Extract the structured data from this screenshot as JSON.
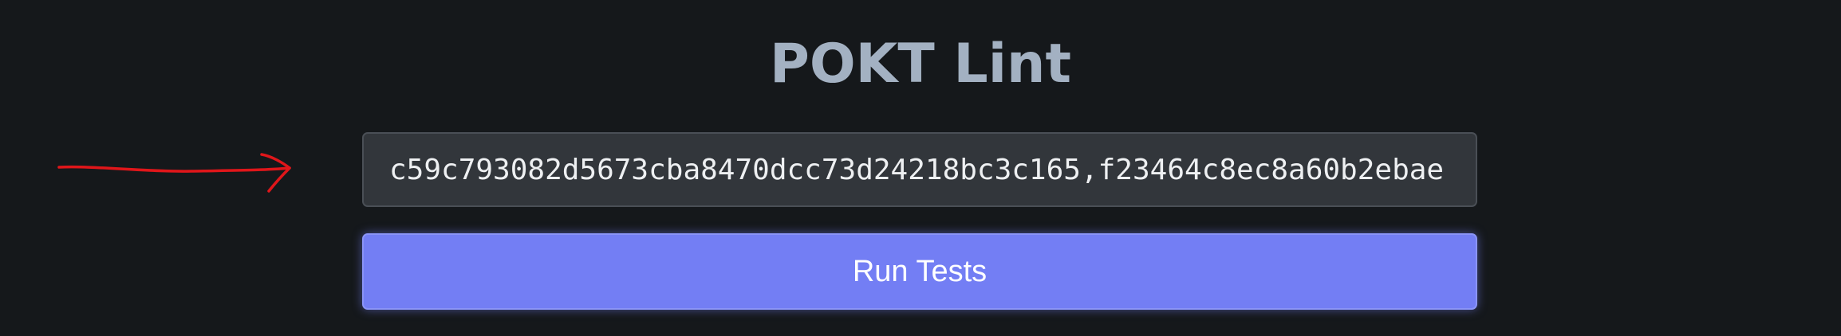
{
  "app": {
    "title": "POKT Lint"
  },
  "form": {
    "input_value": "c59c793082d5673cba8470dcc73d24218bc3c165,f23464c8ec8a60b2ebae",
    "run_button_label": "Run Tests"
  },
  "colors": {
    "background": "#15181b",
    "title": "#a3b1c2",
    "input_background": "#32363b",
    "button_accent": "#737ef4",
    "annotation_arrow": "#e0161a"
  }
}
